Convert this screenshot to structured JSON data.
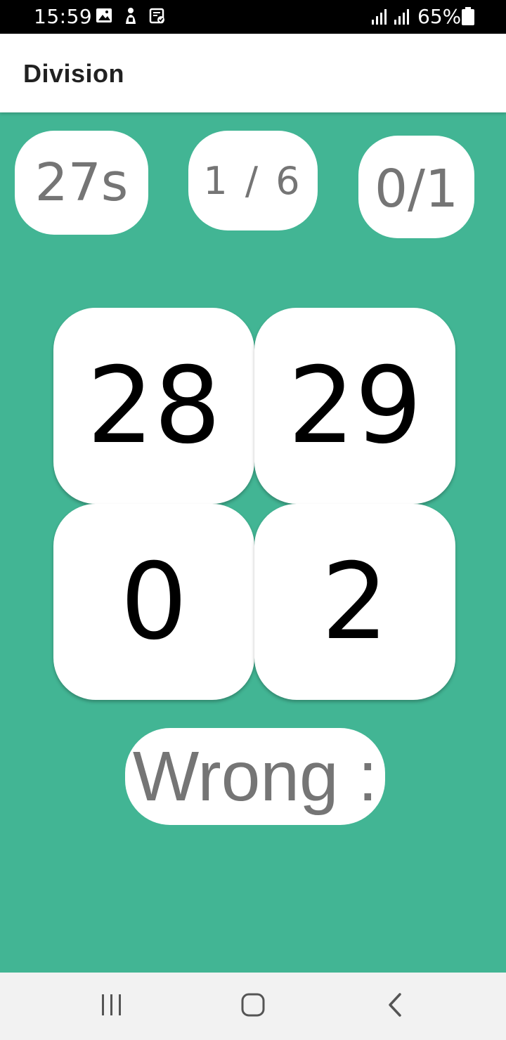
{
  "status_bar": {
    "time": "15:59",
    "battery_percent": "65%",
    "icons": [
      "image-icon",
      "person-download-icon",
      "clipboard-check-icon",
      "signal-icon",
      "signal-icon",
      "battery-icon"
    ]
  },
  "app_bar": {
    "title": "Division"
  },
  "stats": {
    "timer": "27s",
    "progress": "1 / 6",
    "score": "0/1"
  },
  "answers": [
    "28",
    "29",
    "0",
    "2"
  ],
  "result": {
    "text": "Wrong :"
  },
  "nav_bar": {
    "icons": [
      "recents-icon",
      "home-icon",
      "back-icon"
    ]
  },
  "colors": {
    "background": "#42b594",
    "tile": "#ffffff",
    "muted_text": "#757575",
    "answer_text": "#000000"
  }
}
